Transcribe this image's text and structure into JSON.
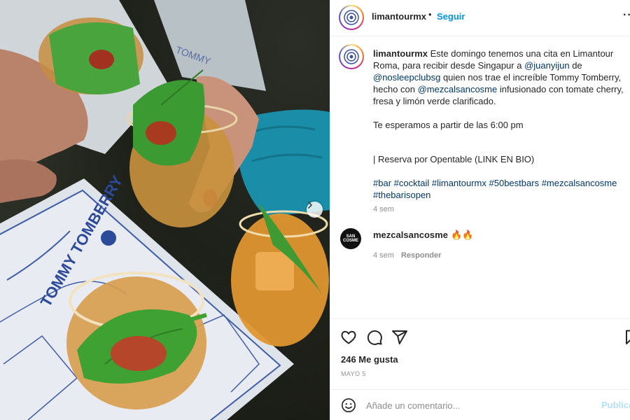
{
  "post": {
    "username": "limantourmx",
    "follow_label": "Seguir",
    "header_separator": "•",
    "more_label": "···",
    "caption": {
      "username": "limantourmx",
      "line1_a": "Este domingo tenemos una cita en Limantour Roma, para recibir desde Singapur a ",
      "mention_1": "@juanyijun",
      "line1_b": " de ",
      "mention_2": "@nosleepclubsg",
      "line1_c": " quien nos trae el increíble Tommy Tomberry, hecho con ",
      "mention_3": "@mezcalsancosme",
      "line1_d": " infusionado con tomate cherry, fresa y limón verde clarificado.",
      "paragraph_2": "Te esperamos a partir de las 6:00 pm",
      "paragraph_3": "| Reserva por Opentable (LINK EN BIO)",
      "hashtags": [
        "#bar",
        "#cocktail",
        "#limantourmx",
        "#50bestbars",
        "#mezcalsancosme",
        "#thebarisopen"
      ]
    },
    "caption_time": "4 sem",
    "comment": {
      "username": "mezcalsancosme",
      "text": "🔥🔥",
      "avatar_text_1": "SAN",
      "avatar_text_2": "COSME",
      "time": "4 sem",
      "reply_label": "Responder"
    },
    "likes": "246 Me gusta",
    "date": "MAYO 5",
    "add_comment": {
      "placeholder": "Añade un comentario...",
      "publish_label": "Publicar"
    }
  },
  "photo": {
    "card_text": "TOMMY TOMBERRY"
  },
  "icons": {
    "like": "heart-icon",
    "comment": "comment-icon",
    "share": "share-icon",
    "save": "bookmark-icon",
    "emoji": "smiley-icon",
    "next": "chevron-right-icon"
  },
  "colors": {
    "link_blue": "#0095f6",
    "mention_blue": "#00376b",
    "muted_gray": "#8e8e8e",
    "publish_disabled": "#b2dffc"
  }
}
